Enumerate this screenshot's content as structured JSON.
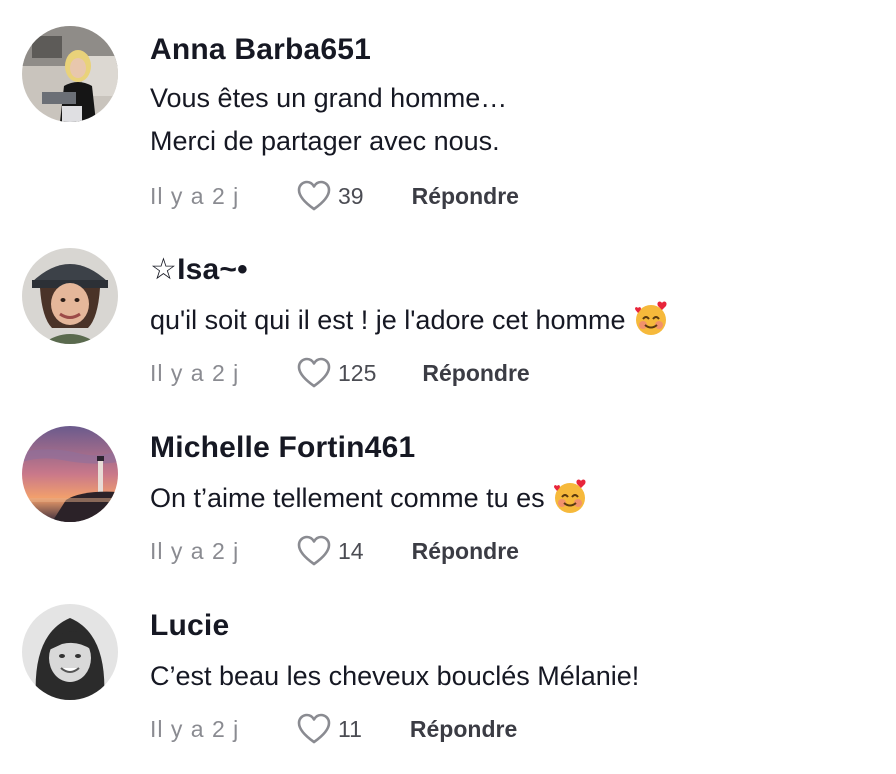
{
  "comments": [
    {
      "username": "Anna Barba651",
      "lines": [
        "Vous êtes un grand homme…",
        "Merci de partager avec nous."
      ],
      "time": "Il y a 2 j",
      "likes": "39",
      "reply": "Répondre",
      "emoji": ""
    },
    {
      "username": "☆Isa~•",
      "lines": [
        "qu'il soit qui il est ! je l'adore cet homme"
      ],
      "time": "Il y a 2 j",
      "likes": "125",
      "reply": "Répondre",
      "emoji": "smiling-face-with-hearts"
    },
    {
      "username": "Michelle Fortin461",
      "lines": [
        "On t’aime tellement comme tu es"
      ],
      "time": "Il y a 2 j",
      "likes": "14",
      "reply": "Répondre",
      "emoji": "smiling-face-with-hearts"
    },
    {
      "username": "Lucie",
      "lines": [
        "C’est beau les cheveux bouclés Mélanie!"
      ],
      "time": "Il y a 2 j",
      "likes": "11",
      "reply": "Répondre",
      "emoji": ""
    }
  ],
  "icons": {
    "like": "heart-outline-icon",
    "emoji": "smiling-face-with-hearts-emoji"
  },
  "colors": {
    "text": "#161823",
    "meta": "#8a8b91",
    "heart": "#8a8b91"
  }
}
